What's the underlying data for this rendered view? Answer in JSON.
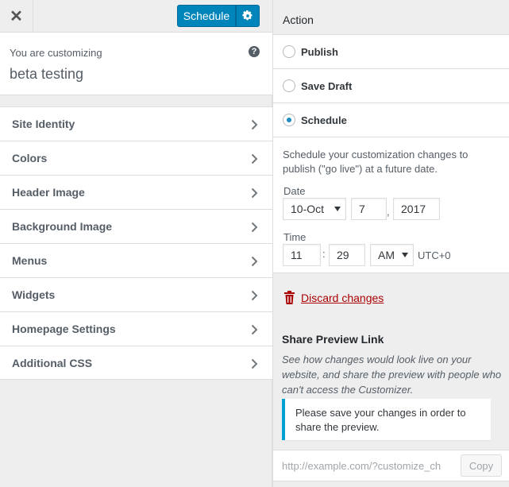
{
  "header": {
    "close_icon": "close-icon",
    "close_glyph": "✕",
    "schedule_label": "Schedule",
    "settings_icon": "gear-icon",
    "accent_color": "#0085ba"
  },
  "customizing": {
    "prefix": "You are customizing",
    "site_title": "beta testing",
    "help_icon": "help-icon",
    "help_glyph": "?"
  },
  "sections": [
    {
      "label": "Site Identity"
    },
    {
      "label": "Colors"
    },
    {
      "label": "Header Image"
    },
    {
      "label": "Background Image"
    },
    {
      "label": "Menus"
    },
    {
      "label": "Widgets"
    },
    {
      "label": "Homepage Settings"
    },
    {
      "label": "Additional CSS"
    }
  ],
  "publish_settings": {
    "heading": "Action",
    "options": [
      {
        "label": "Publish",
        "checked": false
      },
      {
        "label": "Save Draft",
        "checked": false
      },
      {
        "label": "Schedule",
        "checked": true
      }
    ],
    "schedule_description": "Schedule your customization changes to publish (\"go live\") at a future date.",
    "date_label": "Date",
    "month_value": "10-Oct",
    "day_value": "7",
    "date_separator": ",",
    "year_value": "2017",
    "time_label": "Time",
    "hour_value": "11",
    "time_separator": ":",
    "minute_value": "29",
    "ampm_value": "AM",
    "timezone": "UTC+0",
    "discard_label": "Discard changes",
    "discard_color": "#aa0000"
  },
  "share": {
    "heading": "Share Preview Link",
    "description": "See how changes would look live on your website, and share the preview with people who can't access the Customizer.",
    "notice": "Please save your changes in order to share the preview.",
    "notice_color": "#00a0d2",
    "url": "http://example.com/?customize_ch",
    "copy_label": "Copy"
  }
}
